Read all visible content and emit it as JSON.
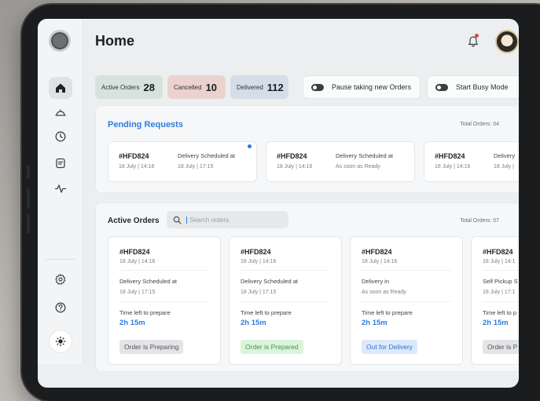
{
  "header": {
    "title": "Home"
  },
  "stats": [
    {
      "label": "Active Orders",
      "value": "28"
    },
    {
      "label": "Cancelled",
      "value": "10"
    },
    {
      "label": "Delivered",
      "value": "112"
    }
  ],
  "toggles": {
    "pause": "Pause taking new Orders",
    "busy": "Start Busy Mode"
  },
  "pending": {
    "title": "Pending Requests",
    "total": "Total Orders: 04",
    "cards": [
      {
        "id": "#HFD824",
        "datetime": "18 July | 14:16",
        "status": "Delivery Scheduled at",
        "status_value": "18 July | 17:15",
        "unread": true
      },
      {
        "id": "#HFD824",
        "datetime": "18 July | 14:16",
        "status": "Delivery Scheduled at",
        "status_value": "As soon as Ready",
        "unread": false
      },
      {
        "id": "#HFD824",
        "datetime": "18 July | 14:16",
        "status": "Delivery",
        "status_value": "18 July |",
        "unread": false
      }
    ]
  },
  "active": {
    "title": "Active Orders",
    "search_placeholder": "Search orders",
    "total": "Total Orders: 07",
    "time_label": "Time left to prepare",
    "cards": [
      {
        "id": "#HFD824",
        "datetime": "18 July | 14:16",
        "status": "Delivery Scheduled at",
        "status_value": "18 July | 17:15",
        "time_label": "Time left to prepare",
        "time": "2h 15m",
        "badge": "Order is Preparing",
        "badge_color": "#e3e4e6"
      },
      {
        "id": "#HFD824",
        "datetime": "18 July | 14:16",
        "status": "Delivery Scheduled at",
        "status_value": "18 July | 17:15",
        "time_label": "Time left to prepare",
        "time": "2h 15m",
        "badge": "Order is Prepared",
        "badge_color": "#dcf3dc"
      },
      {
        "id": "#HFD824",
        "datetime": "18 July | 14:16",
        "status": "Delivery in",
        "status_value": "As soon as Ready",
        "time_label": "Time left to prepare",
        "time": "2h 15m",
        "badge": "Out for Delivery",
        "badge_color": "#dde9fb"
      },
      {
        "id": "#HFD824",
        "datetime": "18 July | 14:1",
        "status": "Self Pickup S",
        "status_value": "18 July | 17:1",
        "time_label": "Time left to p",
        "time": "2h 15m",
        "badge": "Order is P",
        "badge_color": "#e3e4e6"
      }
    ]
  },
  "sidebar": {
    "icons": [
      "home-icon",
      "cloche-icon",
      "clock-icon",
      "receipt-icon",
      "activity-icon",
      "settings-icon",
      "help-icon",
      "sun-icon"
    ]
  },
  "colors": {
    "accent": "#2f7be0",
    "notification": "#e0453a"
  }
}
